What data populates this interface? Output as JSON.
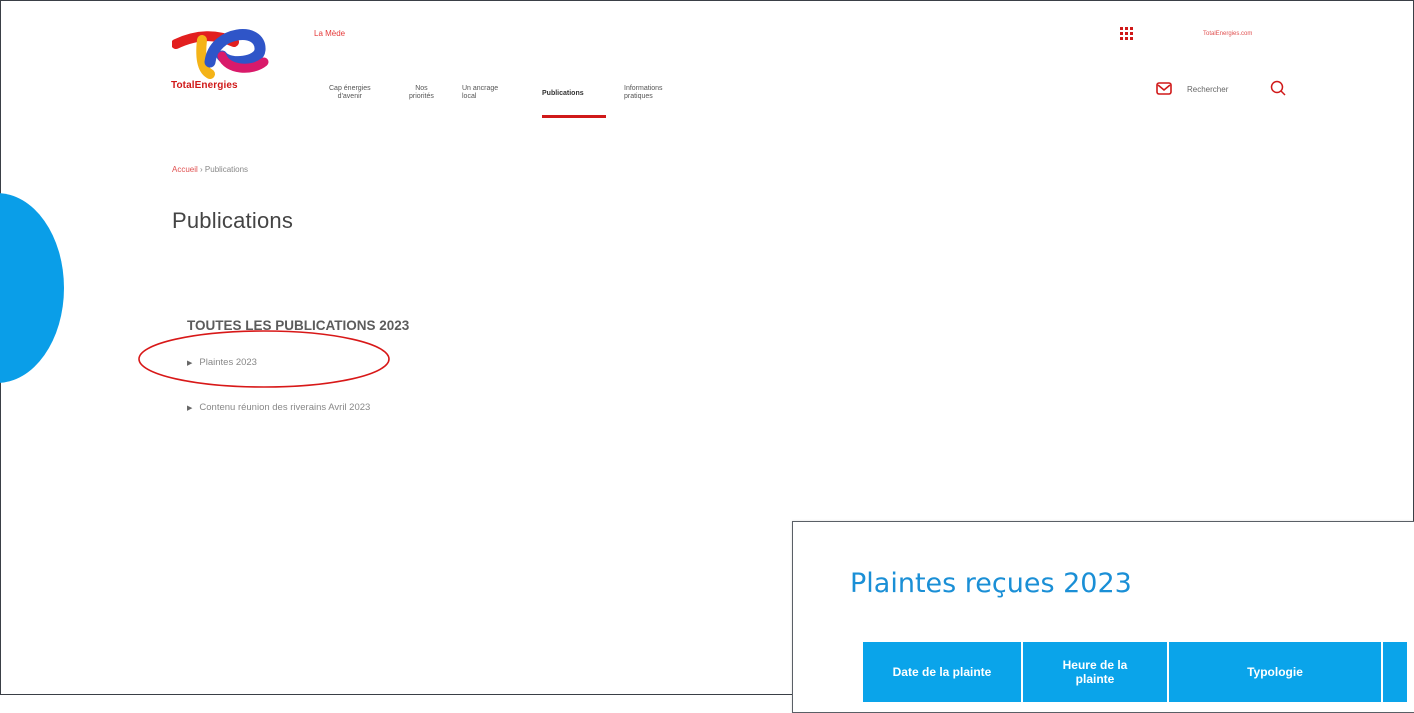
{
  "header": {
    "brand": "TotalEnergies",
    "site_name": "La Mède",
    "external_link": "TotalEnergies.com",
    "search_label": "Rechercher",
    "colors": {
      "brand_red": "#d01919",
      "accent_blue": "#0a9ee8"
    },
    "nav": [
      {
        "label_line1": "Cap énergies",
        "label_line2": "d'avenir"
      },
      {
        "label_line1": "Nos",
        "label_line2": "priorités"
      },
      {
        "label_line1": "Un ancrage",
        "label_line2": "local"
      },
      {
        "label_line1": "Publications",
        "label_line2": "",
        "active": true
      },
      {
        "label_line1": "Informations",
        "label_line2": "pratiques"
      }
    ],
    "icons": [
      "apps-grid-icon",
      "mail-icon",
      "search-icon"
    ]
  },
  "breadcrumb": {
    "home": "Accueil",
    "separator": " › ",
    "current": "Publications"
  },
  "page": {
    "title": "Publications",
    "section_title": "TOUTES LES PUBLICATIONS 2023",
    "items": [
      {
        "label": "Plaintes 2023",
        "highlighted": true
      },
      {
        "label": "Contenu réunion des riverains Avril 2023"
      }
    ]
  },
  "card": {
    "title": "Plaintes reçues 2023",
    "columns": [
      {
        "label_line1": "Date de la plainte",
        "label_line2": ""
      },
      {
        "label_line1": "Heure de la",
        "label_line2": "plainte"
      },
      {
        "label_line1": "Typologie",
        "label_line2": ""
      }
    ]
  }
}
